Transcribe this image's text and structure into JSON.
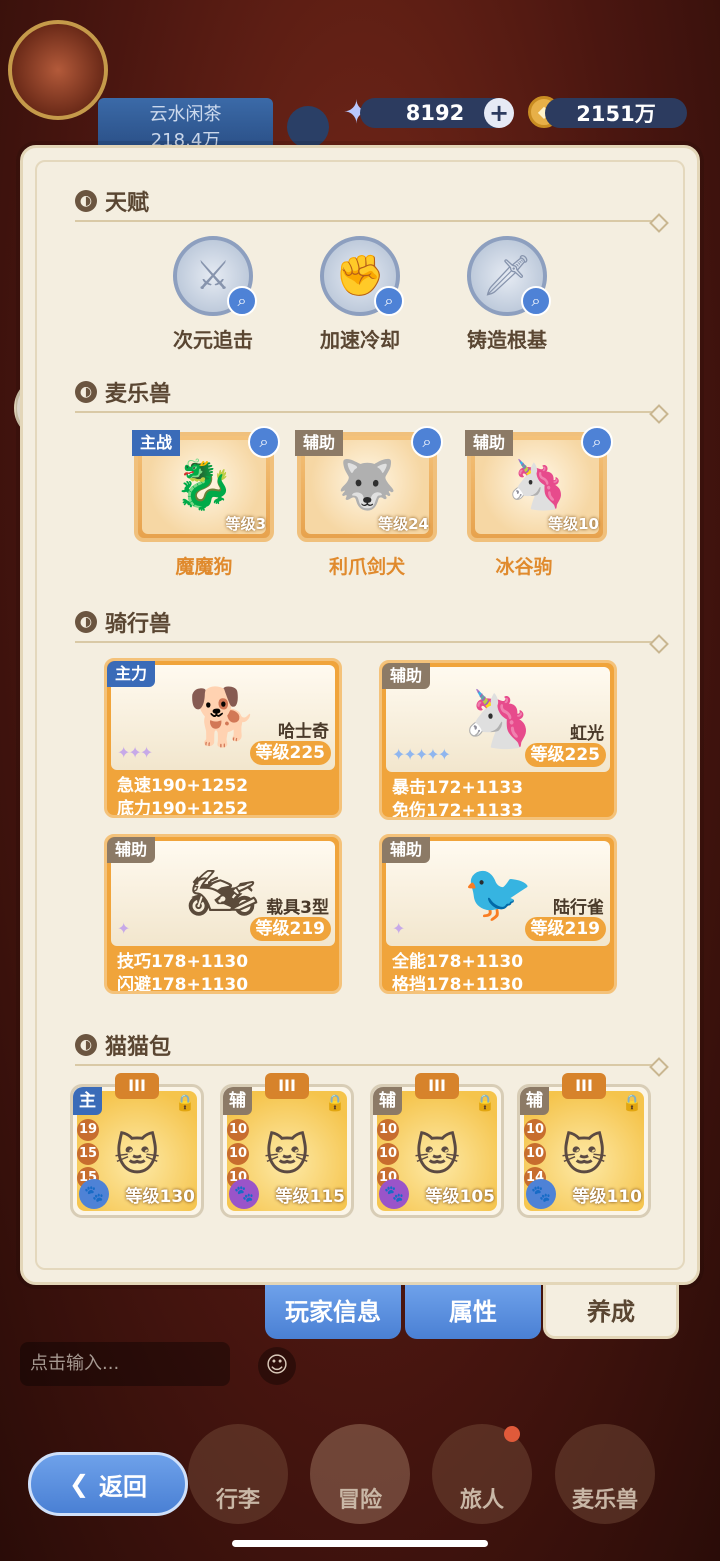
{
  "player": {
    "name": "云水闲茶",
    "power": "218.4万"
  },
  "resources": {
    "gems": "8192",
    "coins": "2151万"
  },
  "sections": {
    "talent": "天赋",
    "pets": "麦乐兽",
    "mounts": "骑行兽",
    "cats": "猫猫包"
  },
  "talents": [
    {
      "label": "次元追击"
    },
    {
      "label": "加速冷却"
    },
    {
      "label": "铸造根基"
    }
  ],
  "pets": [
    {
      "tag": "主战",
      "level": "等级3",
      "name": "魔魔狗"
    },
    {
      "tag": "辅助",
      "level": "等级24",
      "name": "利爪剑犬"
    },
    {
      "tag": "辅助",
      "level": "等级10",
      "name": "冰谷驹"
    }
  ],
  "mounts": [
    {
      "tag": "主力",
      "name": "哈士奇",
      "level": "等级225",
      "stars": "✦✦✦",
      "stat1": "急速190+1252",
      "stat2": "底力190+1252"
    },
    {
      "tag": "辅助",
      "name": "虹光",
      "level": "等级225",
      "stars": "✦✦✦✦✦",
      "stat1": "暴击172+1133",
      "stat2": "免伤172+1133"
    },
    {
      "tag": "辅助",
      "name": "载具3型",
      "level": "等级219",
      "stars": "✦",
      "stat1": "技巧178+1130",
      "stat2": "闪避178+1130"
    },
    {
      "tag": "辅助",
      "name": "陆行雀",
      "level": "等级219",
      "stars": "✦",
      "stat1": "全能178+1130",
      "stat2": "格挡178+1130"
    }
  ],
  "cats": [
    {
      "tier": "III",
      "tag": "主",
      "n1": "19",
      "n2": "15",
      "n3": "15",
      "level": "等级130"
    },
    {
      "tier": "III",
      "tag": "辅",
      "n1": "10",
      "n2": "10",
      "n3": "10",
      "level": "等级115"
    },
    {
      "tier": "III",
      "tag": "辅",
      "n1": "10",
      "n2": "10",
      "n3": "10",
      "level": "等级105"
    },
    {
      "tier": "III",
      "tag": "辅",
      "n1": "10",
      "n2": "10",
      "n3": "14",
      "level": "等级110"
    }
  ],
  "tabs": {
    "player_info": "玩家信息",
    "attributes": "属性",
    "develop": "养成"
  },
  "chat": {
    "placeholder": "点击输入..."
  },
  "nav": {
    "back": "返回",
    "bag": "行李",
    "adventure": "冒险",
    "traveler": "旅人",
    "pets": "麦乐兽"
  },
  "colors": {
    "accent_blue": "#4a80d4",
    "panel": "#f4eee0",
    "card_orange": "#f0a43b"
  }
}
